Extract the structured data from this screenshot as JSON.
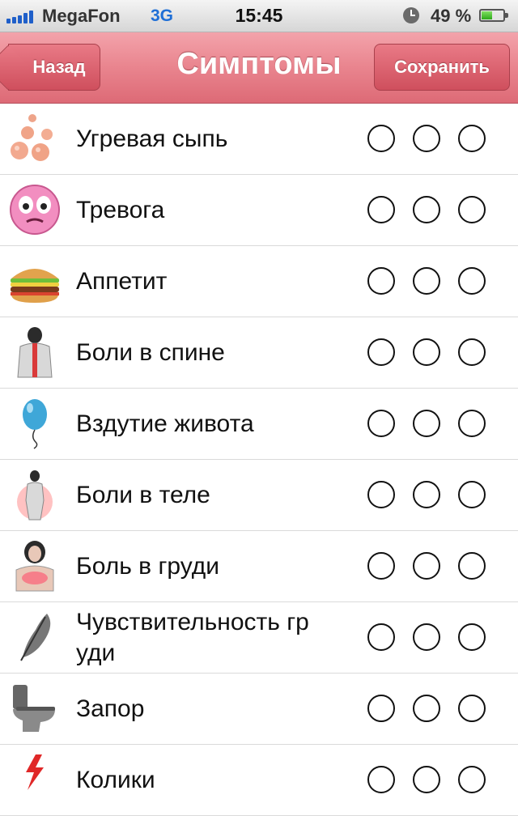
{
  "status_bar": {
    "carrier": "MegaFon",
    "network": "3G",
    "time": "15:45",
    "battery": "49 %",
    "battery_level": 0.49,
    "icons": [
      "signal-bars-icon",
      "alarm-clock-icon",
      "battery-icon"
    ]
  },
  "nav": {
    "back_label": "Назад",
    "title": "Симптомы",
    "save_label": "Сохранить",
    "accent_color": "#e47f8a"
  },
  "symptoms": [
    {
      "label": "Угревая сыпь",
      "icon": "acne-icon"
    },
    {
      "label": "Тревога",
      "icon": "anxious-face-icon"
    },
    {
      "label": "Аппетит",
      "icon": "burger-icon"
    },
    {
      "label": "Боли в спине",
      "icon": "back-pain-icon"
    },
    {
      "label": "Вздутие живота",
      "icon": "balloon-icon"
    },
    {
      "label": "Боли в теле",
      "icon": "body-pain-icon"
    },
    {
      "label": "Боль в груди",
      "icon": "chest-pain-icon"
    },
    {
      "label": "Чувствительность гр уди",
      "icon": "feather-icon"
    },
    {
      "label": "Запор",
      "icon": "toilet-icon"
    },
    {
      "label": "Колики",
      "icon": "lightning-icon"
    }
  ],
  "severity_options": [
    "level-1",
    "level-2",
    "level-3"
  ]
}
